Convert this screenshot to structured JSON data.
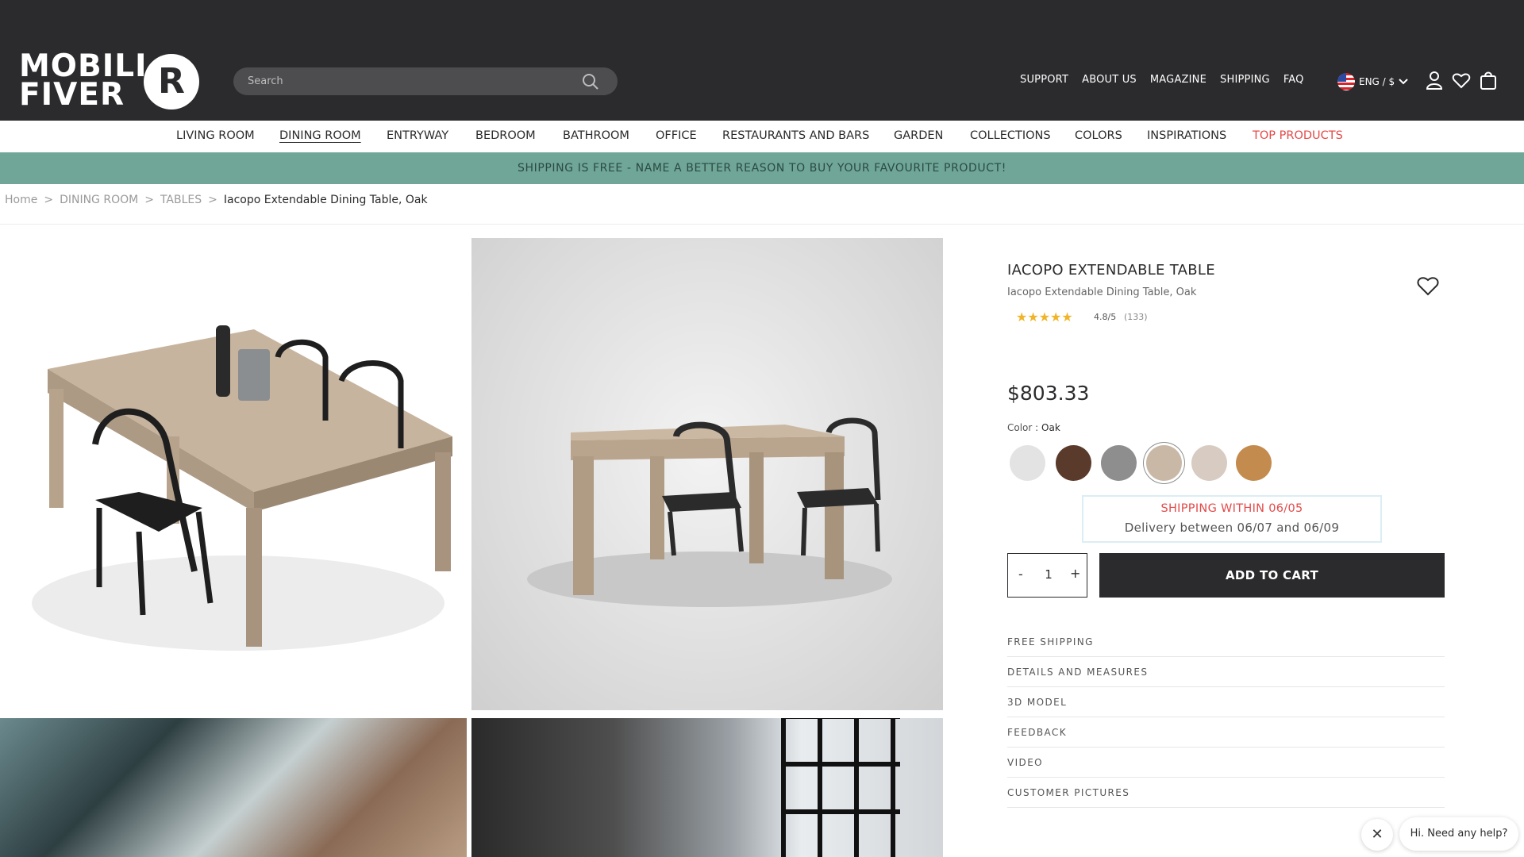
{
  "header": {
    "logo_text_line1": "MOBILI",
    "logo_text_line2": "FIVER",
    "logo_mark": "R",
    "search_placeholder": "Search",
    "links": [
      "SUPPORT",
      "ABOUT US",
      "MAGAZINE",
      "SHIPPING",
      "FAQ"
    ],
    "language": "ENG / $",
    "icons": [
      "user-icon",
      "heart-icon",
      "bag-icon"
    ]
  },
  "categories": [
    "LIVING ROOM",
    "DINING ROOM",
    "ENTRYWAY",
    "BEDROOM",
    "BATHROOM",
    "OFFICE",
    "RESTAURANTS AND BARS",
    "GARDEN",
    "COLLECTIONS",
    "COLORS",
    "INSPIRATIONS",
    "TOP PRODUCTS"
  ],
  "active_category": "DINING ROOM",
  "promo_text": "SHIPPING IS FREE - NAME A BETTER REASON TO BUY YOUR FAVOURITE PRODUCT!",
  "breadcrumb": [
    "Home",
    ">",
    "DINING ROOM",
    ">",
    "TABLES",
    ">",
    "Iacopo Extendable Dining Table, Oak"
  ],
  "product": {
    "title": "IACOPO EXTENDABLE TABLE",
    "subtitle": "Iacopo Extendable Dining Table, Oak",
    "stars": "★★★★★",
    "rating": "4.8/5",
    "reviews": "(133)",
    "price": "$803.33",
    "color_label": "Color : ",
    "color_value": "Oak",
    "swatch_colors": [
      "#e3e3e3",
      "#5a3a2a",
      "#8e8e8e",
      "#c9b8a6",
      "#d7cbc2",
      "#c38b4e"
    ],
    "selected_swatch": "#c9b8a6",
    "shipping_within": "SHIPPING WITHIN 06/05",
    "delivery": "Delivery between 06/07 and 06/09",
    "qty_minus": "-",
    "qty_value": "1",
    "qty_plus": "+",
    "add_to_cart": "ADD TO CART",
    "accordion": [
      "FREE SHIPPING",
      "DETAILS AND MEASURES",
      "3D MODEL",
      "FEEDBACK",
      "VIDEO",
      "CUSTOMER PICTURES"
    ]
  },
  "chat": {
    "close_glyph": "✕",
    "prompt": "Hi. Need any help?"
  }
}
